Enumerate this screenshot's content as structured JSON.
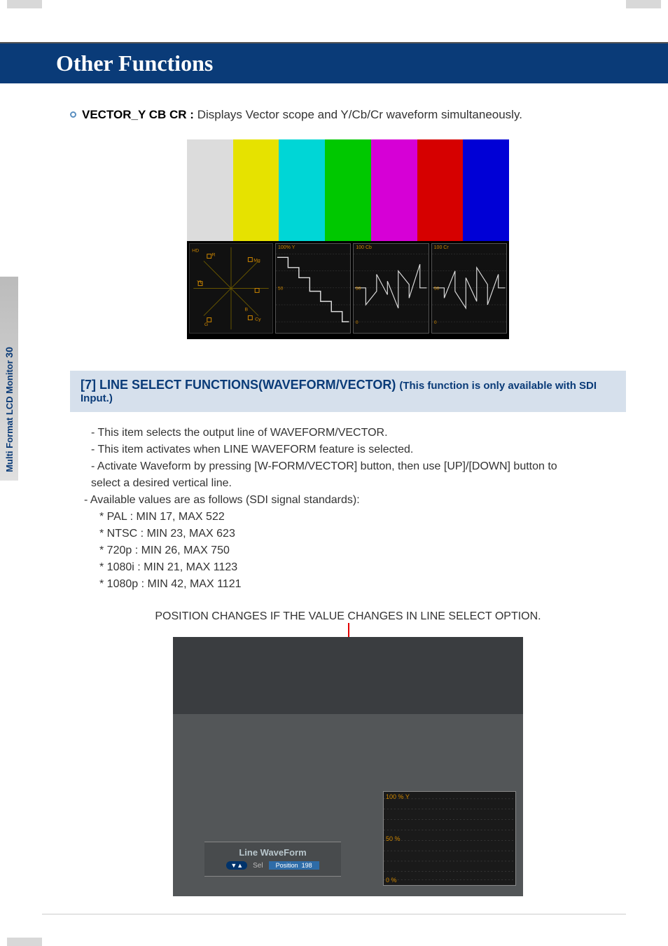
{
  "header": {
    "title": "Other Functions"
  },
  "side": {
    "label_prefix": "Multi Format LCD Monitor ",
    "page_number": "30"
  },
  "bullet": {
    "label": "VECTOR_Y CB CR : ",
    "desc": "Displays Vector scope and Y/Cb/Cr waveform simultaneously."
  },
  "screenshot1": {
    "waveforms": {
      "y_label": "100% Y",
      "cb_label": "100 Cb",
      "cr_label": "100 Cr"
    }
  },
  "section7": {
    "title_main": "[7] LINE SELECT FUNCTIONS(WAVEFORM/VECTOR) ",
    "title_sub": "(This function is only available with SDI Input.)",
    "lines": [
      " - This item selects the output line of WAVEFORM/VECTOR.",
      " - This item activates when LINE WAVEFORM feature is selected.",
      " - Activate Waveform by pressing [W-FORM/VECTOR] button, then use  [UP]/[DOWN] button to",
      "   select a desired vertical line.",
      "- Available values are as follows (SDI signal standards):",
      "  * PAL : MIN 17, MAX 522",
      "  * NTSC : MIN 23, MAX 623",
      "  * 720p : MIN 26, MAX 750",
      "  * 1080i : MIN 21, MAX 1123",
      "  * 1080p : MIN 42, MAX 1121"
    ]
  },
  "caption": "POSITION CHANGES IF THE VALUE CHANGES IN LINE SELECT OPTION.",
  "screenshot2": {
    "box_title": "Line WaveForm",
    "badge_icon": "▼▲",
    "sel_label": "Sel",
    "pos_label": "Position",
    "pos_value": "198",
    "graph_labels": {
      "p100": "100 % Y",
      "p50": "50 %",
      "p0": "0 %"
    }
  }
}
